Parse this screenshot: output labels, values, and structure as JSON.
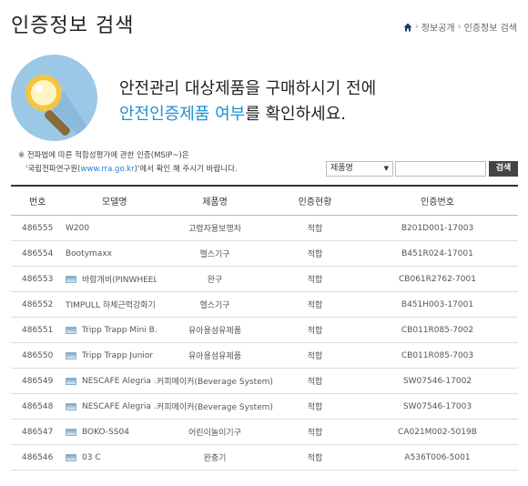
{
  "header": {
    "title": "인증정보 검색",
    "breadcrumb": [
      "정보공개",
      "인증정보 검색"
    ]
  },
  "hero": {
    "line1": "안전관리 대상제품을 구매하시기 전에",
    "line2_highlight": "안전인증제품 여부",
    "line2_rest": "를 확인하세요."
  },
  "notice": {
    "line1": "※ 전파법에 따른 적합성평가에 관한 인증(MSIP~)은",
    "line2_prefix": "'국립전파연구원(",
    "line2_link": "www.rra.go.kr",
    "line2_suffix": ")'에서 확인 해 주시기 바랍니다."
  },
  "search": {
    "select_value": "제품명",
    "input_value": "",
    "button_label": "검색"
  },
  "table": {
    "headers": [
      "번호",
      "모델명",
      "제품명",
      "인증현황",
      "인증번호"
    ],
    "rows": [
      {
        "no": "486555",
        "model": "W200",
        "thumb": false,
        "product": "고령자용보행차",
        "status": "적합",
        "cert": "B201D001-17003"
      },
      {
        "no": "486554",
        "model": "Bootymaxx",
        "thumb": false,
        "product": "헬스기구",
        "status": "적합",
        "cert": "B451R024-17001"
      },
      {
        "no": "486553",
        "model": "바람개비(PINWHEEL)",
        "thumb": true,
        "product": "완구",
        "status": "적합",
        "cert": "CB061R2762-7001"
      },
      {
        "no": "486552",
        "model": "TIMPULL 하체근력강화기",
        "thumb": false,
        "product": "헬스기구",
        "status": "적합",
        "cert": "B451H003-17001"
      },
      {
        "no": "486551",
        "model": "Tripp Trapp Mini B…",
        "thumb": true,
        "product": "유아용섬유제품",
        "status": "적합",
        "cert": "CB011R085-7002"
      },
      {
        "no": "486550",
        "model": "Tripp Trapp Junior …",
        "thumb": true,
        "product": "유아용섬유제품",
        "status": "적합",
        "cert": "CB011R085-7003"
      },
      {
        "no": "486549",
        "model": "NESCAFE Alegria …",
        "thumb": true,
        "product": "커피메이커(Beverage System)",
        "status": "적합",
        "cert": "SW07546-17002"
      },
      {
        "no": "486548",
        "model": "NESCAFE Alegria …",
        "thumb": true,
        "product": "커피메이커(Beverage System)",
        "status": "적합",
        "cert": "SW07546-17003"
      },
      {
        "no": "486547",
        "model": "BOKO-SS04",
        "thumb": true,
        "product": "어린이놀이기구",
        "status": "적합",
        "cert": "CA021M002-5019B"
      },
      {
        "no": "486546",
        "model": "03 C",
        "thumb": true,
        "product": "완충기",
        "status": "적합",
        "cert": "A536T006-5001"
      }
    ]
  }
}
